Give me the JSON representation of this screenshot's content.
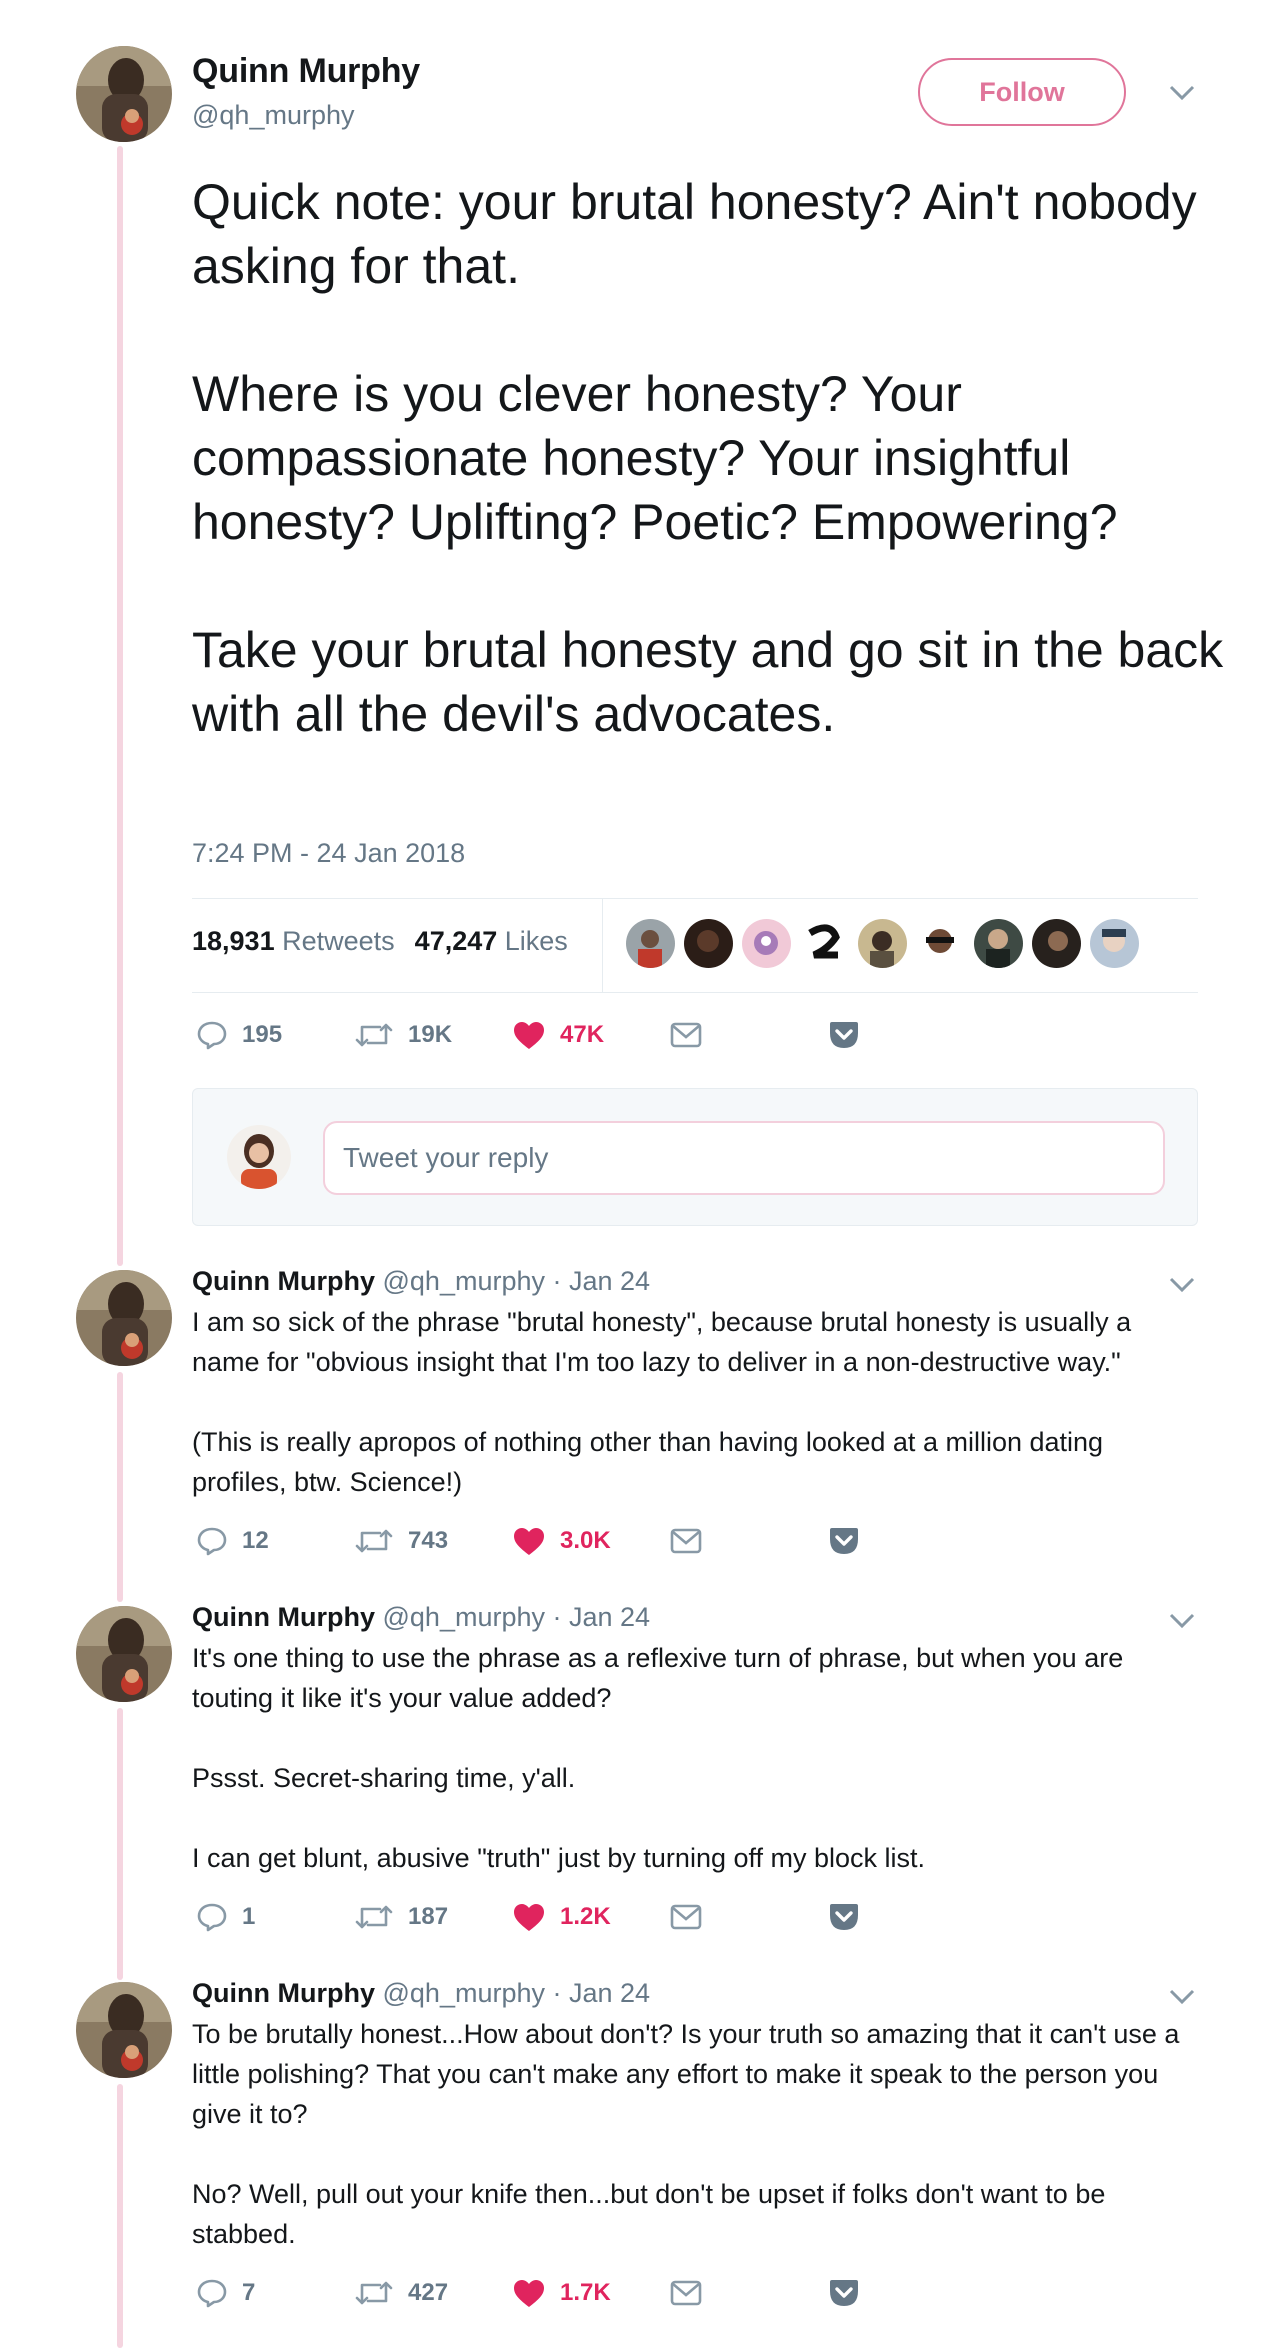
{
  "header": {
    "name": "Quinn Murphy",
    "handle": "@qh_murphy",
    "follow_label": "Follow"
  },
  "main_tweet": {
    "paragraphs": [
      "Quick note: your brutal honesty? Ain't nobody asking for that.",
      "Where is you clever honesty? Your compassionate honesty? Your insightful honesty? Uplifting? Poetic? Empowering?",
      "Take your brutal honesty and go sit in the back with all the devil's advocates."
    ],
    "timestamp": "7:24 PM - 24 Jan 2018",
    "retweets_count": "18,931",
    "retweets_label": "Retweets",
    "likes_count": "47,247",
    "likes_label": "Likes",
    "actions": {
      "replies": "195",
      "retweets": "19K",
      "likes": "47K"
    }
  },
  "reply_box": {
    "placeholder": "Tweet your reply"
  },
  "colors": {
    "accent": "#e0759a",
    "like": "#e0245e",
    "muted": "#657786",
    "thread": "#f5d5e0"
  },
  "thread": [
    {
      "name": "Quinn Murphy",
      "handle_date": "@qh_murphy · Jan 24",
      "paragraphs": [
        "I am so sick of the phrase \"brutal honesty\", because brutal honesty is usually a name for \"obvious insight that I'm too lazy to deliver in a non-destructive way.\"",
        "(This is really apropos of nothing other than having looked at a million dating profiles, btw. Science!)"
      ],
      "actions": {
        "replies": "12",
        "retweets": "743",
        "likes": "3.0K"
      }
    },
    {
      "name": "Quinn Murphy",
      "handle_date": "@qh_murphy · Jan 24",
      "paragraphs": [
        "It's one thing to use the phrase as a reflexive turn of phrase, but when you are touting it like it's your value added?",
        "Pssst. Secret-sharing time, y'all.",
        "I can get blunt, abusive \"truth\" just by turning off my block list."
      ],
      "actions": {
        "replies": "1",
        "retweets": "187",
        "likes": "1.2K"
      }
    },
    {
      "name": "Quinn Murphy",
      "handle_date": "@qh_murphy · Jan 24",
      "paragraphs": [
        "To be brutally honest...How about don't? Is your truth so amazing that it can't use a little polishing? That you can't make any effort to make it speak to the person you give it to?",
        "No? Well, pull out your knife then...but don't be upset if folks don't want to be stabbed."
      ],
      "actions": {
        "replies": "7",
        "retweets": "427",
        "likes": "1.7K"
      }
    }
  ]
}
